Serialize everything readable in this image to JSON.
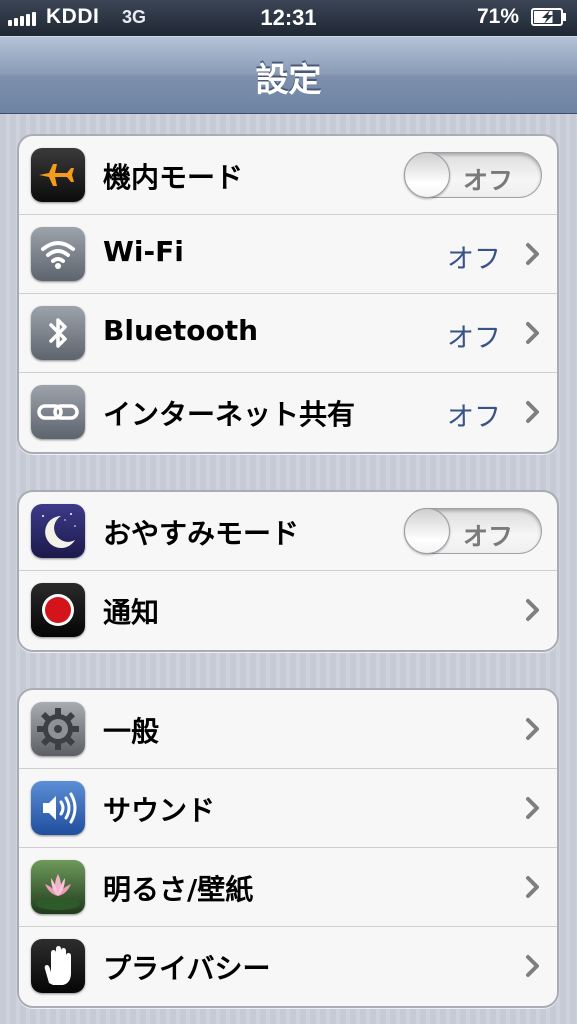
{
  "status_bar": {
    "carrier": "KDDI",
    "network": "3G",
    "time": "12:31",
    "battery_percent": "71%",
    "battery_level": 0.71
  },
  "nav": {
    "title": "設定"
  },
  "groups": [
    {
      "rows": [
        {
          "label": "機内モード",
          "icon": "airplane-icon",
          "toggle": "オフ"
        },
        {
          "label": "Wi-Fi",
          "icon": "wifi-icon",
          "value": "オフ"
        },
        {
          "label": "Bluetooth",
          "icon": "bluetooth-icon",
          "value": "オフ"
        },
        {
          "label": "インターネット共有",
          "icon": "hotspot-icon",
          "value": "オフ"
        }
      ]
    },
    {
      "rows": [
        {
          "label": "おやすみモード",
          "icon": "moon-icon",
          "toggle": "オフ"
        },
        {
          "label": "通知",
          "icon": "notification-icon"
        }
      ]
    },
    {
      "rows": [
        {
          "label": "一般",
          "icon": "gear-icon"
        },
        {
          "label": "サウンド",
          "icon": "speaker-icon"
        },
        {
          "label": "明るさ/壁紙",
          "icon": "flower-icon"
        },
        {
          "label": "プライバシー",
          "icon": "hand-icon"
        }
      ]
    }
  ],
  "colors": {
    "nav_blue": "#7d90ae",
    "value_blue": "#385487",
    "background": "#c7ccd6"
  }
}
